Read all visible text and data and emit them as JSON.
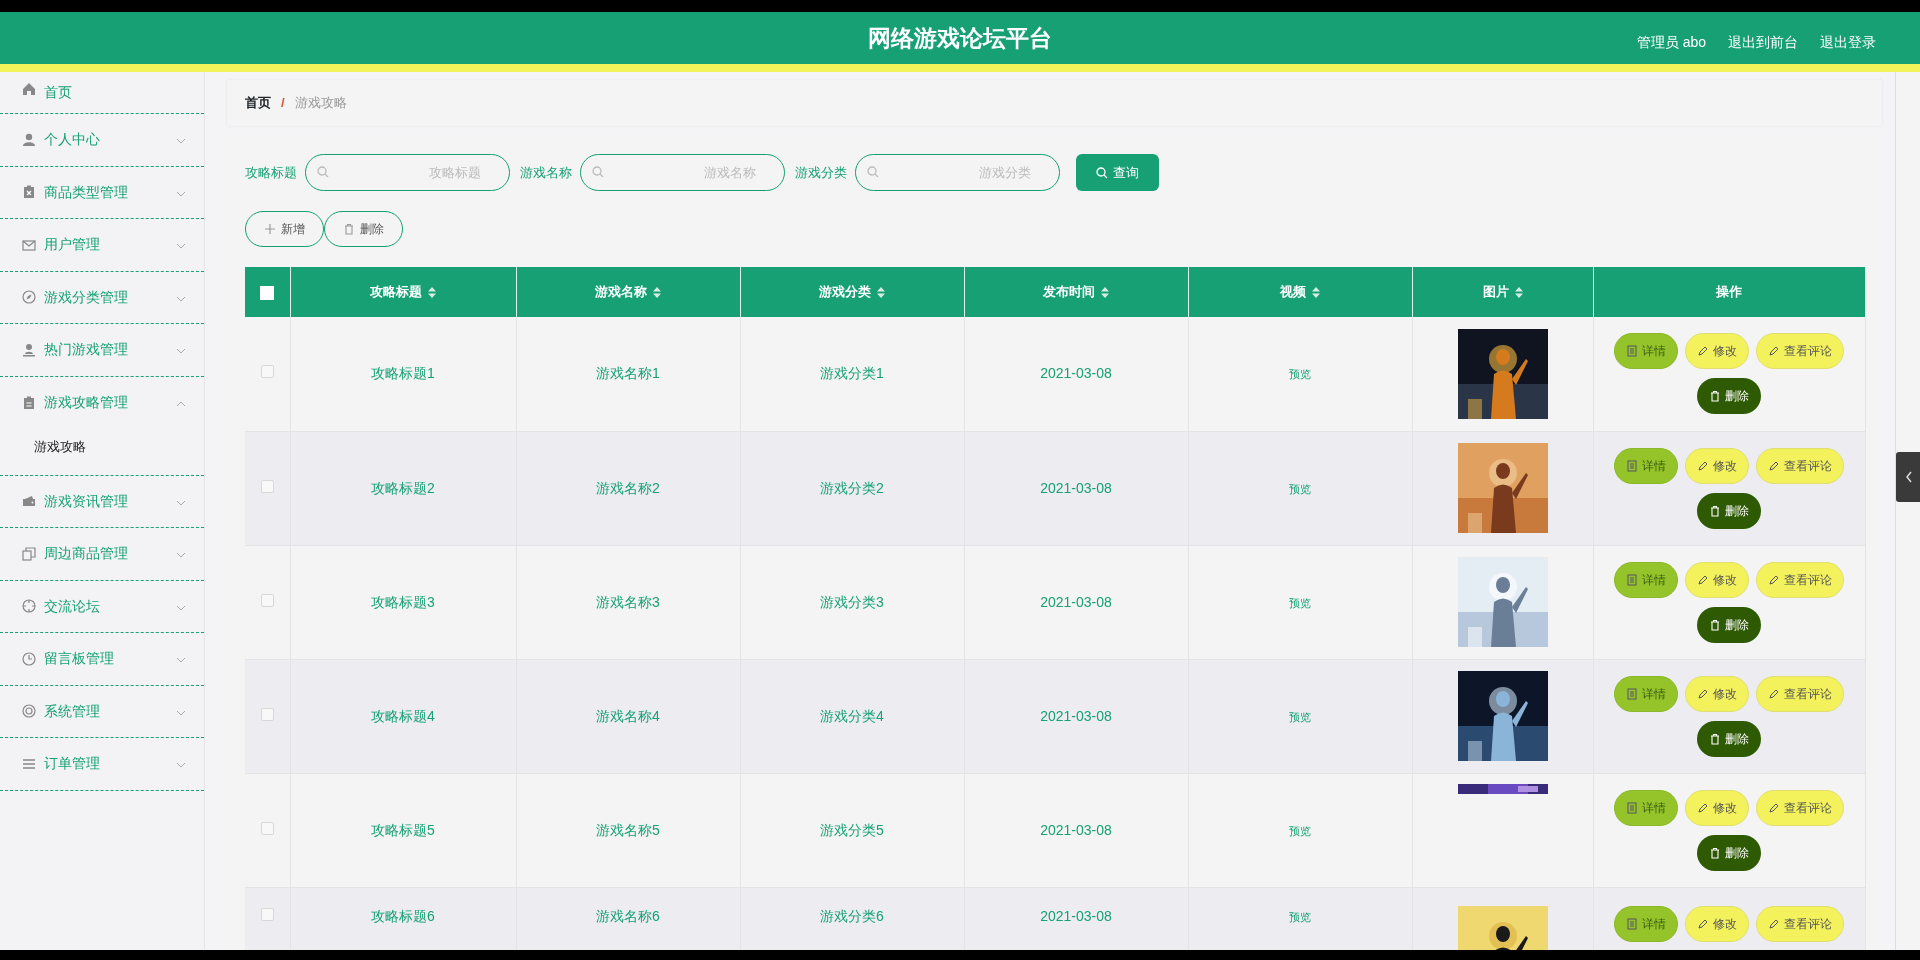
{
  "header": {
    "title": "网络游戏论坛平台",
    "links": [
      "管理员 abo",
      "退出到前台",
      "退出登录"
    ]
  },
  "sidebar": {
    "items": [
      {
        "label": "首页",
        "expandable": false
      },
      {
        "label": "个人中心",
        "expandable": true,
        "expanded": false
      },
      {
        "label": "商品类型管理",
        "expandable": true,
        "expanded": false
      },
      {
        "label": "用户管理",
        "expandable": true,
        "expanded": false
      },
      {
        "label": "游戏分类管理",
        "expandable": true,
        "expanded": false
      },
      {
        "label": "热门游戏管理",
        "expandable": true,
        "expanded": false
      },
      {
        "label": "游戏攻略管理",
        "expandable": true,
        "expanded": true,
        "children": [
          {
            "label": "游戏攻略",
            "selected": true
          }
        ]
      },
      {
        "label": "游戏资讯管理",
        "expandable": true,
        "expanded": false
      },
      {
        "label": "周边商品管理",
        "expandable": true,
        "expanded": false
      },
      {
        "label": "交流论坛",
        "expandable": true,
        "expanded": false
      },
      {
        "label": "留言板管理",
        "expandable": true,
        "expanded": false
      },
      {
        "label": "系统管理",
        "expandable": true,
        "expanded": false
      },
      {
        "label": "订单管理",
        "expandable": true,
        "expanded": false
      }
    ]
  },
  "breadcrumb": {
    "separator": "/",
    "items": [
      {
        "label": "首页",
        "current": false
      },
      {
        "label": "游戏攻略",
        "current": true
      }
    ]
  },
  "search": {
    "fields": [
      {
        "label": "攻略标题",
        "placeholder": "攻略标题"
      },
      {
        "label": "游戏名称",
        "placeholder": "游戏名称"
      },
      {
        "label": "游戏分类",
        "placeholder": "游戏分类"
      }
    ],
    "button": "查询"
  },
  "toolbar": [
    {
      "label": "新增",
      "kind": "add"
    },
    {
      "label": "删除",
      "kind": "delete"
    }
  ],
  "table": {
    "select_all": {
      "checked": false
    },
    "columns": [
      {
        "label": "攻略标题",
        "sortable": true
      },
      {
        "label": "游戏名称",
        "sortable": true
      },
      {
        "label": "游戏分类",
        "sortable": true
      },
      {
        "label": "发布时间",
        "sortable": true
      },
      {
        "label": "视频",
        "sortable": true
      },
      {
        "label": "图片",
        "sortable": true
      },
      {
        "label": "操作",
        "sortable": false
      }
    ],
    "rows": [
      {
        "checked": false,
        "cells": [
          "攻略标题1",
          "游戏名称1",
          "游戏分类1",
          "2021-03-08"
        ],
        "video": "预览",
        "image": {
          "kind": "picture",
          "loaded": true
        },
        "actions": [
          {
            "label": "详情",
            "kind": "detail"
          },
          {
            "label": "修改",
            "kind": "edit"
          },
          {
            "label": "查看评论",
            "kind": "comments"
          },
          {
            "label": "删除",
            "kind": "delete"
          }
        ]
      },
      {
        "checked": false,
        "cells": [
          "攻略标题2",
          "游戏名称2",
          "游戏分类2",
          "2021-03-08"
        ],
        "video": "预览",
        "image": {
          "kind": "picture",
          "loaded": true
        },
        "actions": [
          {
            "label": "详情",
            "kind": "detail"
          },
          {
            "label": "修改",
            "kind": "edit"
          },
          {
            "label": "查看评论",
            "kind": "comments"
          },
          {
            "label": "删除",
            "kind": "delete"
          }
        ]
      },
      {
        "checked": false,
        "cells": [
          "攻略标题3",
          "游戏名称3",
          "游戏分类3",
          "2021-03-08"
        ],
        "video": "预览",
        "image": {
          "kind": "picture",
          "loaded": true
        },
        "actions": [
          {
            "label": "详情",
            "kind": "detail"
          },
          {
            "label": "修改",
            "kind": "edit"
          },
          {
            "label": "查看评论",
            "kind": "comments"
          },
          {
            "label": "删除",
            "kind": "delete"
          }
        ]
      },
      {
        "checked": false,
        "cells": [
          "攻略标题4",
          "游戏名称4",
          "游戏分类4",
          "2021-03-08"
        ],
        "video": "预览",
        "image": {
          "kind": "picture",
          "loaded": true
        },
        "actions": [
          {
            "label": "详情",
            "kind": "detail"
          },
          {
            "label": "修改",
            "kind": "edit"
          },
          {
            "label": "查看评论",
            "kind": "comments"
          },
          {
            "label": "删除",
            "kind": "delete"
          }
        ]
      },
      {
        "checked": false,
        "cells": [
          "攻略标题5",
          "游戏名称5",
          "游戏分类5",
          "2021-03-08"
        ],
        "video": "预览",
        "image": {
          "kind": "picture",
          "loaded": false
        },
        "actions": [
          {
            "label": "详情",
            "kind": "detail"
          },
          {
            "label": "修改",
            "kind": "edit"
          },
          {
            "label": "查看评论",
            "kind": "comments"
          },
          {
            "label": "删除",
            "kind": "delete"
          }
        ]
      },
      {
        "checked": false,
        "cells": [
          "攻略标题6",
          "游戏名称6",
          "游戏分类6",
          "2021-03-08"
        ],
        "video": "预览",
        "image": {
          "kind": "picture",
          "loaded": true
        },
        "actions": [
          {
            "label": "详情",
            "kind": "detail"
          },
          {
            "label": "修改",
            "kind": "edit"
          },
          {
            "label": "查看评论",
            "kind": "comments"
          }
        ]
      }
    ]
  }
}
